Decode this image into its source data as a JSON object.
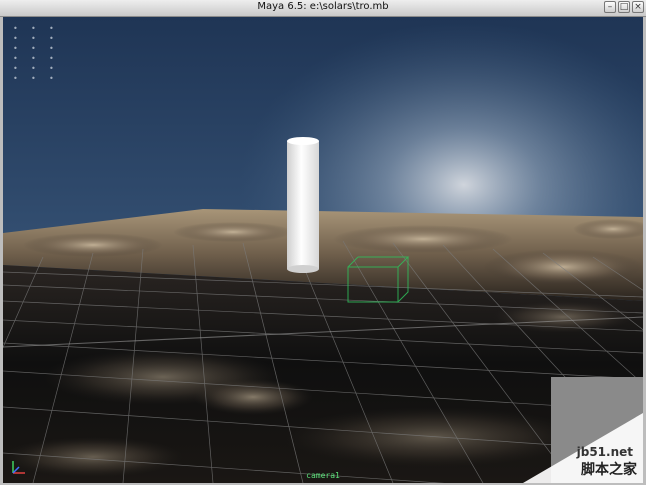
{
  "window": {
    "title": "Maya 6.5: e:\\solars\\tro.mb",
    "buttons": {
      "minimize": "–",
      "zoom": "□",
      "close": "×"
    }
  },
  "viewport": {
    "hud_rows": [
      [
        "•",
        "•",
        "•"
      ],
      [
        "•",
        "•",
        "•"
      ],
      [
        "•",
        "•",
        "•"
      ],
      [
        "•",
        "•",
        "•"
      ],
      [
        "•",
        "•",
        "•"
      ],
      [
        "•",
        "•",
        "•"
      ]
    ],
    "camera_label": "camera1",
    "colors": {
      "sky_top": "#22385a",
      "sky_bottom": "#496685",
      "floor": "#0c0c0c",
      "grid": "#6e6e6e",
      "pillar": "#f4f4f4"
    }
  },
  "watermark": {
    "site": "jb51.net",
    "brand": "脚本之家"
  }
}
